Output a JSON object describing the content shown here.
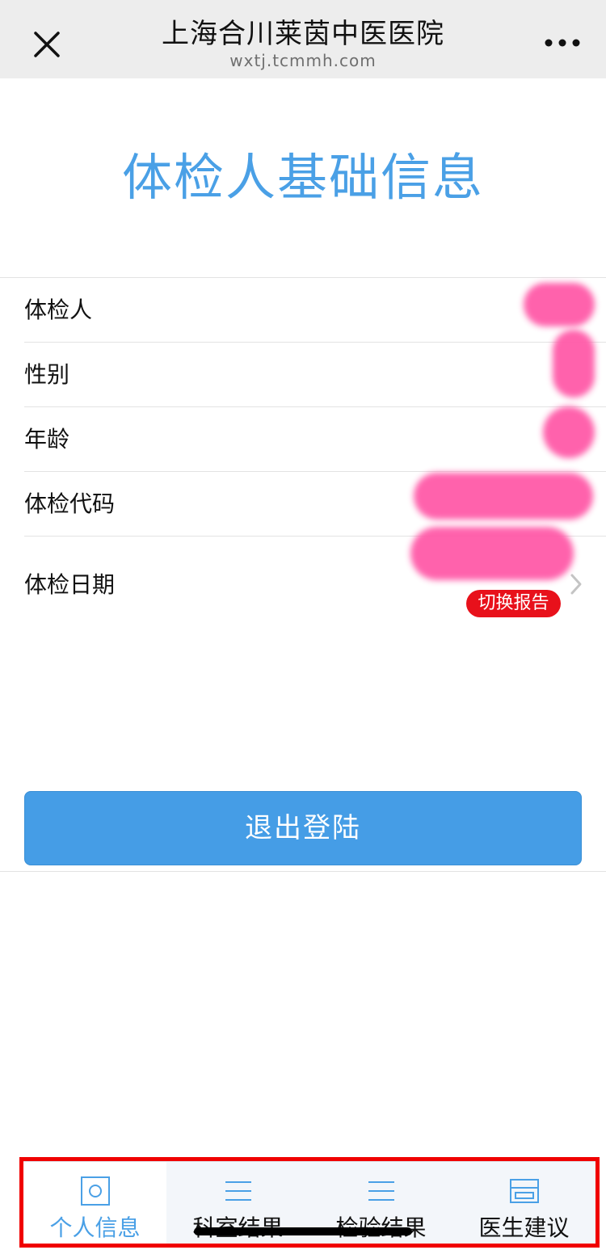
{
  "header": {
    "site_title": "上海合川莱茵中医医院",
    "site_url": "wxtj.tcmmh.com",
    "close_icon": "close-icon",
    "more_icon": "more-icon"
  },
  "page": {
    "title": "体检人基础信息"
  },
  "info": {
    "rows": [
      {
        "label": "体检人",
        "value": ""
      },
      {
        "label": "性别",
        "value": ""
      },
      {
        "label": "年龄",
        "value": ""
      },
      {
        "label": "体检代码",
        "value": ""
      },
      {
        "label": "体检日期",
        "value": ""
      }
    ],
    "switch_report": "切换报告"
  },
  "actions": {
    "logout": "退出登陆"
  },
  "tabs": [
    {
      "label": "个人信息",
      "icon": "person-icon",
      "active": true
    },
    {
      "label": "科室结果",
      "icon": "list-icon",
      "active": false
    },
    {
      "label": "检验结果",
      "icon": "list-icon",
      "active": false
    },
    {
      "label": "医生建议",
      "icon": "card-icon",
      "active": false
    }
  ],
  "colors": {
    "accent": "#4aa0e6",
    "button": "#459de6",
    "badge": "#e8111b",
    "redaction": "#ff5aa8",
    "highlight": "#f00000"
  }
}
